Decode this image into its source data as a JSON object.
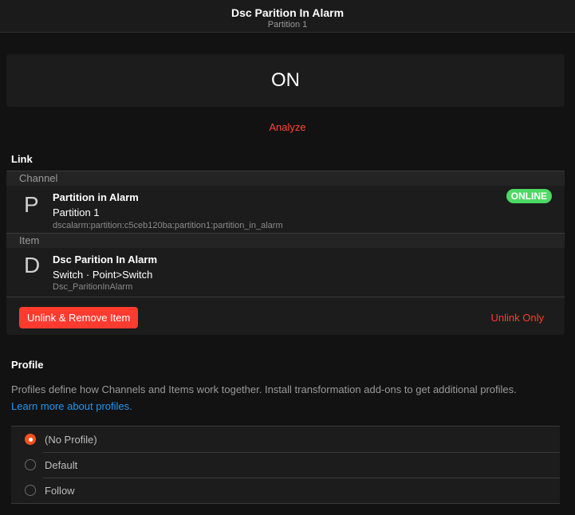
{
  "nav": {
    "title": "Dsc Parition In Alarm",
    "subtitle": "Partition 1"
  },
  "state": "ON",
  "analyze": "Analyze",
  "link": {
    "heading": "Link",
    "channel": {
      "section": "Channel",
      "letter": "P",
      "title": "Partition in Alarm",
      "subtitle": "Partition 1",
      "uid": "dscalarm:partition:c5ceb120ba:partition1:partition_in_alarm",
      "status": "ONLINE"
    },
    "item": {
      "section": "Item",
      "letter": "D",
      "title": "Dsc Parition In Alarm",
      "subtitle": "Switch · Point>Switch",
      "name": "Dsc_ParitionInAlarm"
    },
    "unlink_remove": "Unlink & Remove Item",
    "unlink_only": "Unlink Only"
  },
  "profile": {
    "heading": "Profile",
    "description": "Profiles define how Channels and Items work together. Install transformation add-ons to get additional profiles.",
    "learn_more": "Learn more about profiles.",
    "options": [
      {
        "label": "(No Profile)",
        "selected": true
      },
      {
        "label": "Default",
        "selected": false
      },
      {
        "label": "Follow",
        "selected": false
      }
    ]
  }
}
